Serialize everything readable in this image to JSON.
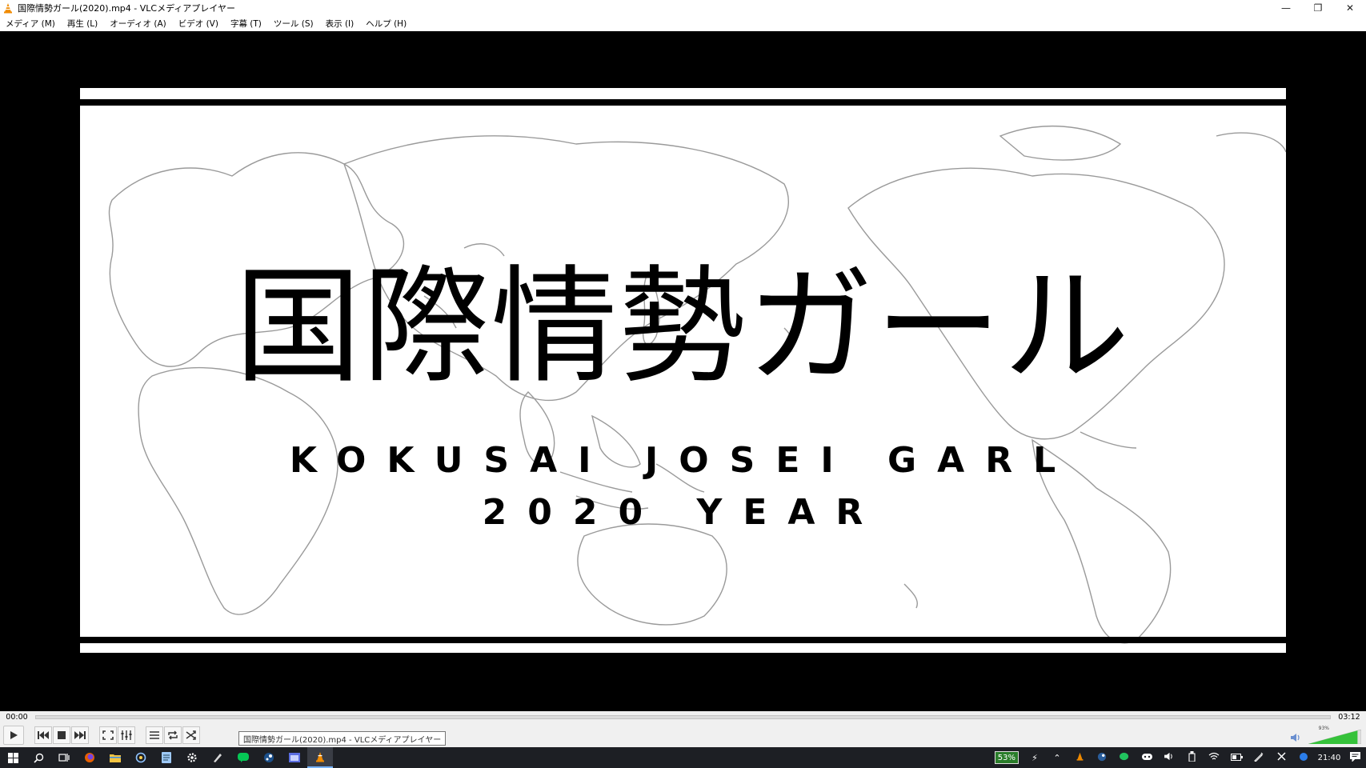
{
  "window": {
    "title": "国際情勢ガール(2020).mp4 - VLCメディアプレイヤー",
    "minimize_glyph": "—",
    "maximize_glyph": "❐",
    "close_glyph": "✕"
  },
  "menu": {
    "items": [
      "メディア (M)",
      "再生 (L)",
      "オーディオ (A)",
      "ビデオ (V)",
      "字幕 (T)",
      "ツール (S)",
      "表示 (I)",
      "ヘルプ (H)"
    ]
  },
  "video": {
    "title_jp": "国際情勢ガール",
    "title_en": "KOKUSAI JOSEI GARL",
    "title_year": "2020 YEAR"
  },
  "seek": {
    "elapsed": "00:00",
    "total": "03:12",
    "progress": 0.0
  },
  "controls": {
    "tooltip": "国際情勢ガール(2020).mp4 - VLCメディアプレイヤー",
    "volume_label": "93%",
    "volume": 0.93,
    "icons": [
      "play-icon",
      "previous-icon",
      "stop-icon",
      "next-icon",
      "fullscreen-icon",
      "extended-settings-icon",
      "playlist-icon",
      "loop-icon",
      "shuffle-icon"
    ]
  },
  "taskbar": {
    "battery": "53%",
    "clock": "21:40",
    "accent": "#77b3ff"
  }
}
